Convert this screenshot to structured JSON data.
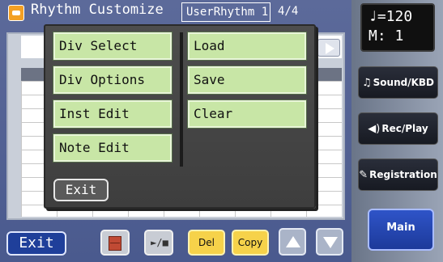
{
  "titlebar": {
    "icon": "rhythm-icon",
    "title": "Rhythm Customize",
    "rhythm_name": "UserRhythm 1",
    "measure_count": "4/4"
  },
  "popup": {
    "left_items": [
      "Div Select",
      "Div Options",
      "Inst Edit",
      "Note Edit"
    ],
    "right_items": [
      "Load",
      "Save",
      "Clear"
    ],
    "exit_label": "Exit"
  },
  "toolbar": {
    "exit_label": "Exit",
    "cabinet_icon": "cabinet-icon",
    "play_stop_label": "►/■",
    "del_label": "Del",
    "copy_label": "Copy",
    "up_icon": "arrow-up-icon",
    "down_icon": "arrow-down-icon"
  },
  "side": {
    "tempo": "♩=120",
    "measure": "M:   1",
    "sound_kbd": "Sound/KBD",
    "sound_icon": "♫",
    "rec_play": "Rec/Play",
    "rec_icon": "◀)",
    "registration": "Registration",
    "registration_icon": "✎",
    "main": "Main"
  },
  "colors": {
    "menu_green": "#c8e6a6",
    "popup_bg": "#454545",
    "accent_blue": "#1f3f9a",
    "yellow": "#f6d24a"
  }
}
